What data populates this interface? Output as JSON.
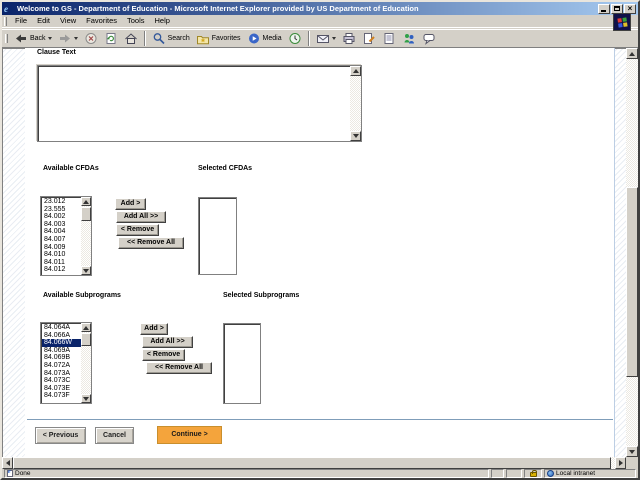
{
  "window": {
    "title": "Welcome to GS - Department of Education - Microsoft Internet Explorer provided by US Department of Education"
  },
  "menu": {
    "items": [
      "File",
      "Edit",
      "View",
      "Favorites",
      "Tools",
      "Help"
    ]
  },
  "toolbar": {
    "back_label": "Back",
    "search_label": "Search",
    "favorites_label": "Favorites",
    "media_label": "Media"
  },
  "page": {
    "clause": {
      "label": "Clause Text",
      "value": ""
    },
    "cfda": {
      "available_label": "Available CFDAs",
      "selected_label": "Selected CFDAs",
      "available_items": [
        "23.012",
        "23.555",
        "84.002",
        "84.003",
        "84.004",
        "84.007",
        "84.009",
        "84.010",
        "84.011",
        "84.012"
      ],
      "selected_items": []
    },
    "subprograms": {
      "available_label": "Available Subprograms",
      "selected_label": "Selected Subprograms",
      "available_items": [
        "84.064A",
        "84.066A",
        "84.066W",
        "84.069A",
        "84.069B",
        "84.072A",
        "84.073A",
        "84.073C",
        "84.073E",
        "84.073F"
      ],
      "selected_index": 2,
      "selected_items": []
    },
    "transfer_buttons": {
      "add": "Add >",
      "add_all": "Add All >>",
      "remove": "< Remove",
      "remove_all": "<< Remove All"
    },
    "nav": {
      "previous": "< Previous",
      "cancel": "Cancel",
      "continue": "Continue >"
    }
  },
  "status_bar": {
    "status": "Done",
    "zone": "Local intranet"
  },
  "colors": {
    "title_from": "#0A246A",
    "title_to": "#A6CAF0",
    "selection_bg": "#0A246A",
    "continue_bg": "#F4A43C",
    "continue_border": "#C98F2D"
  }
}
